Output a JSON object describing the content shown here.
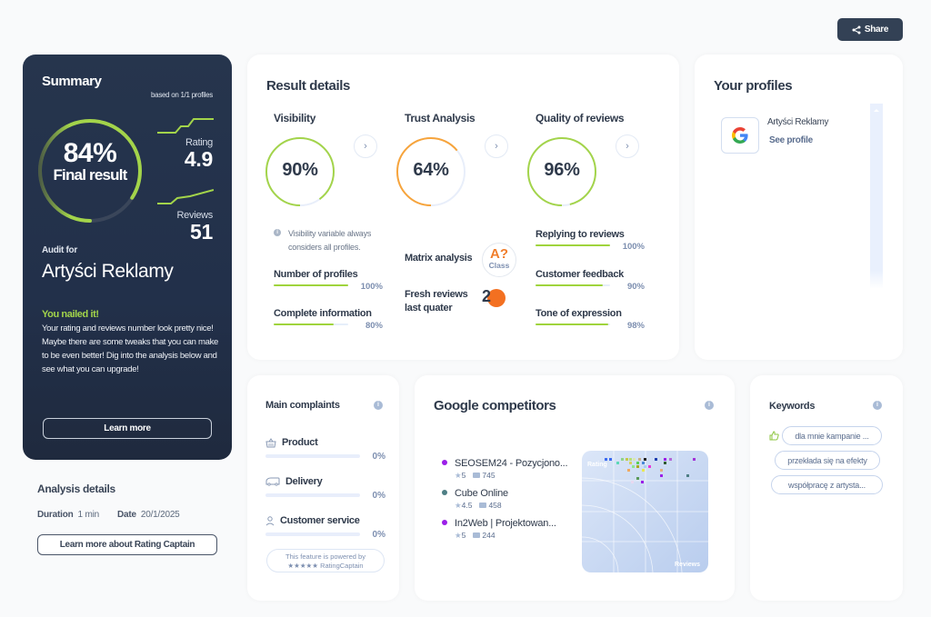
{
  "share": {
    "label": "Share",
    "icon": "share-icon"
  },
  "summary": {
    "title": "Summary",
    "based_on": "based on 1/1 profiles",
    "final_result_value": "84%",
    "final_result_fraction": 0.84,
    "final_result_label": "Final result",
    "rating_label": "Rating",
    "rating_value": "4.9",
    "reviews_label": "Reviews",
    "reviews_value": "51",
    "audit_for_label": "Audit for",
    "company": "Artyści Reklamy",
    "headline": "You nailed it!",
    "description": "Your rating and reviews number look pretty nice! Maybe there are some tweaks that you can make to be even better! Dig into the analysis below and see what you can upgrade!",
    "learn_more": "Learn more",
    "colors": {
      "accent": "#a3d44a",
      "background": "#253349"
    }
  },
  "analysis": {
    "title": "Analysis details",
    "duration_label": "Duration",
    "duration_value": "1 min",
    "date_label": "Date",
    "date_value": "20/1/2025",
    "button": "Learn more about Rating Captain"
  },
  "result_details": {
    "title": "Result details",
    "visibility": {
      "title": "Visibility",
      "value": "90%",
      "fraction": 0.9,
      "color": "#a3d44a"
    },
    "trust": {
      "title": "Trust Analysis",
      "value": "64%",
      "fraction": 0.64,
      "color": "#f7a43b"
    },
    "quality": {
      "title": "Quality of reviews",
      "value": "96%",
      "fraction": 0.96,
      "color": "#a3d44a"
    },
    "note": "Visibility variable always considers all profiles.",
    "visibility_metrics": [
      {
        "label": "Number of profiles",
        "value": "100%",
        "fraction": 1.0
      },
      {
        "label": "Complete information",
        "value": "80%",
        "fraction": 0.8
      }
    ],
    "matrix_label": "Matrix analysis",
    "matrix_class": "A?",
    "matrix_class_label": "Class",
    "fresh_label_1": "Fresh reviews",
    "fresh_label_2": "last quater",
    "fresh_value": "2",
    "quality_metrics": [
      {
        "label": "Replying to reviews",
        "value": "100%",
        "fraction": 1.0
      },
      {
        "label": "Customer feedback",
        "value": "90%",
        "fraction": 0.9
      },
      {
        "label": "Tone of expression",
        "value": "98%",
        "fraction": 0.98
      }
    ]
  },
  "profiles": {
    "title": "Your profiles",
    "items": [
      {
        "name": "Artyści Reklamy",
        "link": "See profile",
        "icon": "google-icon"
      }
    ]
  },
  "complaints": {
    "title": "Main complaints",
    "items": [
      {
        "label": "Product",
        "value": "0%",
        "icon": "basket-icon"
      },
      {
        "label": "Delivery",
        "value": "0%",
        "icon": "van-icon"
      },
      {
        "label": "Customer service",
        "value": "0%",
        "icon": "person-icon"
      }
    ],
    "powered_1": "This feature is powered by",
    "powered_2": "★★★★★ RatingCaptain"
  },
  "competitors": {
    "title": "Google competitors",
    "items": [
      {
        "name": "SEOSEM24 - Pozycjono...",
        "rating": "5",
        "reviews": "745",
        "color": "#9b1fe8"
      },
      {
        "name": "Cube Online",
        "rating": "4.5",
        "reviews": "458",
        "color": "#4e7f85"
      },
      {
        "name": "In2Web | Projektowan...",
        "rating": "5",
        "reviews": "244",
        "color": "#9b1fe8"
      }
    ],
    "chart_y_label": "Rating",
    "chart_x_label": "Reviews"
  },
  "keywords": {
    "title": "Keywords",
    "items": [
      "dla mnie kampanie ...",
      "przekłada się na efekty",
      "współpracę z artysta..."
    ]
  }
}
